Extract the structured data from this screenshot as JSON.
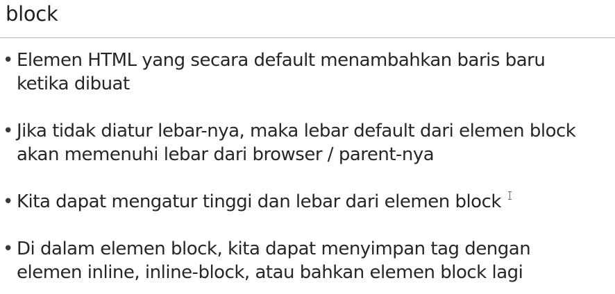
{
  "slide": {
    "title": "block",
    "bullets": [
      {
        "lines": [
          "Elemen HTML yang secara default menambahkan baris baru",
          "ketika dibuat"
        ]
      },
      {
        "lines": [
          "Jika tidak diatur lebar-nya, maka lebar default dari elemen block",
          "akan memenuhi lebar dari browser / parent-nya"
        ]
      },
      {
        "lines": [
          "Kita dapat mengatur tinggi dan lebar dari elemen block"
        ]
      },
      {
        "lines": [
          "Di dalam elemen block, kita dapat menyimpan tag dengan",
          "elemen inline, inline-block, atau bahkan elemen block lagi"
        ]
      }
    ]
  }
}
